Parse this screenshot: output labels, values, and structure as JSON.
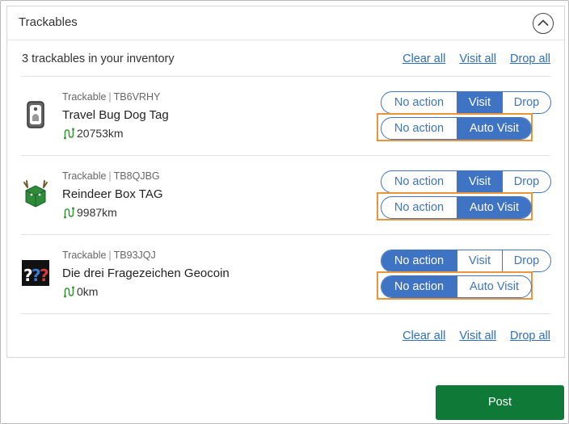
{
  "panel": {
    "title": "Trackables"
  },
  "summary": {
    "text": "3 trackables in your inventory"
  },
  "links": {
    "clear_all": "Clear all",
    "visit_all": "Visit all",
    "drop_all": "Drop all"
  },
  "action_options": [
    "No action",
    "Visit",
    "Drop"
  ],
  "auto_options": [
    "No action",
    "Auto Visit"
  ],
  "items": [
    {
      "type": "Trackable",
      "code": "TB6VRHY",
      "name": "Travel Bug Dog Tag",
      "distance": "20753km",
      "icon": "dog-tag-icon",
      "selected_action": "Visit",
      "selected_auto": "Auto Visit"
    },
    {
      "type": "Trackable",
      "code": "TB8QJBG",
      "name": "Reindeer Box TAG",
      "distance": "9987km",
      "icon": "reindeer-box-icon",
      "selected_action": "Visit",
      "selected_auto": "Auto Visit"
    },
    {
      "type": "Trackable",
      "code": "TB93JQJ",
      "name": "Die drei Fragezeichen Geocoin",
      "distance": "0km",
      "icon": "question-marks-icon",
      "selected_action": "No action",
      "selected_auto": "No action"
    }
  ],
  "post_button": "Post",
  "colors": {
    "accent": "#3f74c4",
    "link": "#2f6fb7",
    "post": "#0f7a37",
    "highlight": "#e8953c",
    "distance_icon": "#3a9a3a"
  }
}
